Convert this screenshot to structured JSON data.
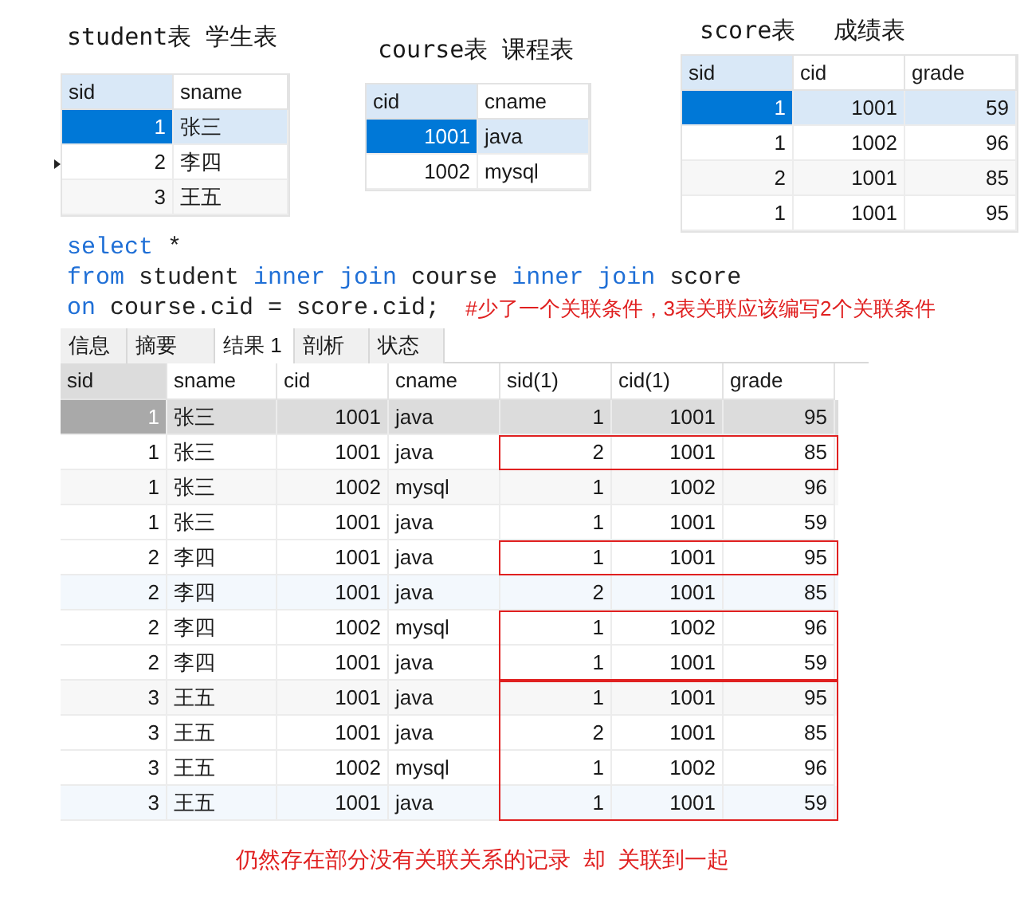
{
  "source_tables": [
    {
      "title": "student表 学生表",
      "focused": true,
      "columns": [
        {
          "label": "sid",
          "kind": "number"
        },
        {
          "label": "sname",
          "kind": "text"
        }
      ],
      "rows": [
        {
          "cells": [
            "1",
            "张三"
          ],
          "selected": true,
          "pointer": false
        },
        {
          "cells": [
            "2",
            "李四"
          ],
          "selected": false,
          "pointer": true
        },
        {
          "cells": [
            "3",
            "王五"
          ],
          "selected": false,
          "pointer": false
        }
      ]
    },
    {
      "title": "course表 课程表",
      "focused": true,
      "columns": [
        {
          "label": "cid",
          "kind": "number"
        },
        {
          "label": "cname",
          "kind": "text"
        }
      ],
      "rows": [
        {
          "cells": [
            "1001",
            "java"
          ],
          "selected": true,
          "pointer": false
        },
        {
          "cells": [
            "1002",
            "mysql"
          ],
          "selected": false,
          "pointer": false
        }
      ]
    },
    {
      "title": "score表　 成绩表",
      "focused": true,
      "columns": [
        {
          "label": "sid",
          "kind": "number"
        },
        {
          "label": "cid",
          "kind": "number"
        },
        {
          "label": "grade",
          "kind": "number"
        }
      ],
      "rows": [
        {
          "cells": [
            "1",
            "1001",
            "59"
          ],
          "selected": true,
          "pointer": false
        },
        {
          "cells": [
            "1",
            "1002",
            "96"
          ],
          "selected": false,
          "pointer": false
        },
        {
          "cells": [
            "2",
            "1001",
            "85"
          ],
          "selected": false,
          "pointer": false
        },
        {
          "cells": [
            "1",
            "1001",
            "95"
          ],
          "selected": false,
          "pointer": false
        }
      ]
    }
  ],
  "sql_lines": [
    [
      {
        "text": "select",
        "kind": "keyword"
      },
      {
        "text": " *",
        "kind": "plain"
      }
    ],
    [
      {
        "text": "from",
        "kind": "keyword"
      },
      {
        "text": " student ",
        "kind": "plain"
      },
      {
        "text": "inner join",
        "kind": "keyword"
      },
      {
        "text": " course ",
        "kind": "plain"
      },
      {
        "text": "inner join",
        "kind": "keyword"
      },
      {
        "text": " score",
        "kind": "plain"
      }
    ],
    [
      {
        "text": "on",
        "kind": "keyword"
      },
      {
        "text": " course.cid = score.cid;",
        "kind": "plain"
      }
    ]
  ],
  "sql_comment": "#少了一个关联条件，3表关联应该编写2个关联条件",
  "tabs": [
    {
      "label": "信息",
      "selected": false
    },
    {
      "label": "摘要",
      "selected": false
    },
    {
      "label": "结果 1",
      "selected": true
    },
    {
      "label": "剖析",
      "selected": false
    },
    {
      "label": "状态",
      "selected": false
    }
  ],
  "result": {
    "focused": false,
    "columns": [
      {
        "label": "sid",
        "kind": "number"
      },
      {
        "label": "sname",
        "kind": "text"
      },
      {
        "label": "cid",
        "kind": "number"
      },
      {
        "label": "cname",
        "kind": "text"
      },
      {
        "label": "sid(1)",
        "kind": "number"
      },
      {
        "label": "cid(1)",
        "kind": "number"
      },
      {
        "label": "grade",
        "kind": "number"
      }
    ],
    "rows": [
      {
        "cells": [
          "1",
          "张三",
          "1001",
          "java",
          "1",
          "1001",
          "95"
        ],
        "selected": true,
        "outlined": false
      },
      {
        "cells": [
          "1",
          "张三",
          "1001",
          "java",
          "2",
          "1001",
          "85"
        ],
        "selected": false,
        "outlined": true,
        "outline_start": true
      },
      {
        "cells": [
          "1",
          "张三",
          "1002",
          "mysql",
          "1",
          "1002",
          "96"
        ],
        "selected": false,
        "outlined": false
      },
      {
        "cells": [
          "1",
          "张三",
          "1001",
          "java",
          "1",
          "1001",
          "59"
        ],
        "selected": false,
        "outlined": false
      },
      {
        "cells": [
          "2",
          "李四",
          "1001",
          "java",
          "1",
          "1001",
          "95"
        ],
        "selected": false,
        "outlined": true,
        "outline_start": true
      },
      {
        "cells": [
          "2",
          "李四",
          "1001",
          "java",
          "2",
          "1001",
          "85"
        ],
        "selected": false,
        "outlined": false
      },
      {
        "cells": [
          "2",
          "李四",
          "1002",
          "mysql",
          "1",
          "1002",
          "96"
        ],
        "selected": false,
        "outlined": true,
        "outline_start": true
      },
      {
        "cells": [
          "2",
          "李四",
          "1001",
          "java",
          "1",
          "1001",
          "59"
        ],
        "selected": false,
        "outlined": true,
        "outline_start": false
      },
      {
        "cells": [
          "3",
          "王五",
          "1001",
          "java",
          "1",
          "1001",
          "95"
        ],
        "selected": false,
        "outlined": true,
        "outline_start": true
      },
      {
        "cells": [
          "3",
          "王五",
          "1001",
          "java",
          "2",
          "1001",
          "85"
        ],
        "selected": false,
        "outlined": true,
        "outline_start": false
      },
      {
        "cells": [
          "3",
          "王五",
          "1002",
          "mysql",
          "1",
          "1002",
          "96"
        ],
        "selected": false,
        "outlined": true,
        "outline_start": false
      },
      {
        "cells": [
          "3",
          "王五",
          "1001",
          "java",
          "1",
          "1001",
          "59"
        ],
        "selected": false,
        "outlined": true,
        "outline_start": false
      }
    ]
  },
  "footer_note": "仍然存在部分没有关联关系的记录  却  关联到一起"
}
